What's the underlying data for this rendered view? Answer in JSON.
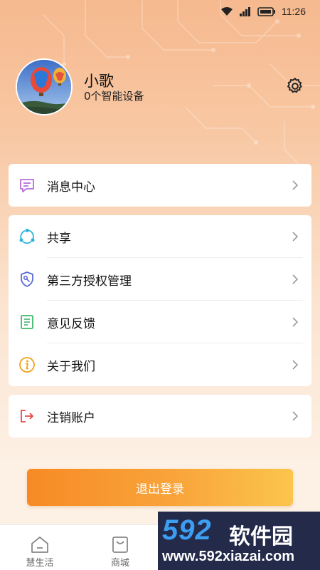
{
  "status_bar": {
    "time": "11:26"
  },
  "profile": {
    "username": "小歌",
    "device_count": "0个智能设备"
  },
  "menu_groups": [
    [
      {
        "label": "消息中心",
        "icon": "message-icon"
      }
    ],
    [
      {
        "label": "共享",
        "icon": "share-icon"
      },
      {
        "label": "第三方授权管理",
        "icon": "key-shield-icon"
      },
      {
        "label": "意见反馈",
        "icon": "feedback-doc-icon"
      },
      {
        "label": "关于我们",
        "icon": "info-icon"
      }
    ],
    [
      {
        "label": "注销账户",
        "icon": "logout-icon"
      }
    ]
  ],
  "logout_button": {
    "label": "退出登录"
  },
  "tabbar": {
    "items": [
      {
        "label": "慧生活",
        "icon": "home-icon"
      },
      {
        "label": "商城",
        "icon": "shop-bag-icon"
      }
    ]
  },
  "watermark": {
    "big": "592",
    "cn": "软件园",
    "url": "www.592xiazai.com"
  },
  "colors": {
    "accent": "#f78a25",
    "message": "#b86cd9",
    "share": "#2bb3d8",
    "key": "#5a6ad4",
    "feedback": "#3fb86a",
    "info": "#f0a21c",
    "logout": "#e24a4a"
  }
}
